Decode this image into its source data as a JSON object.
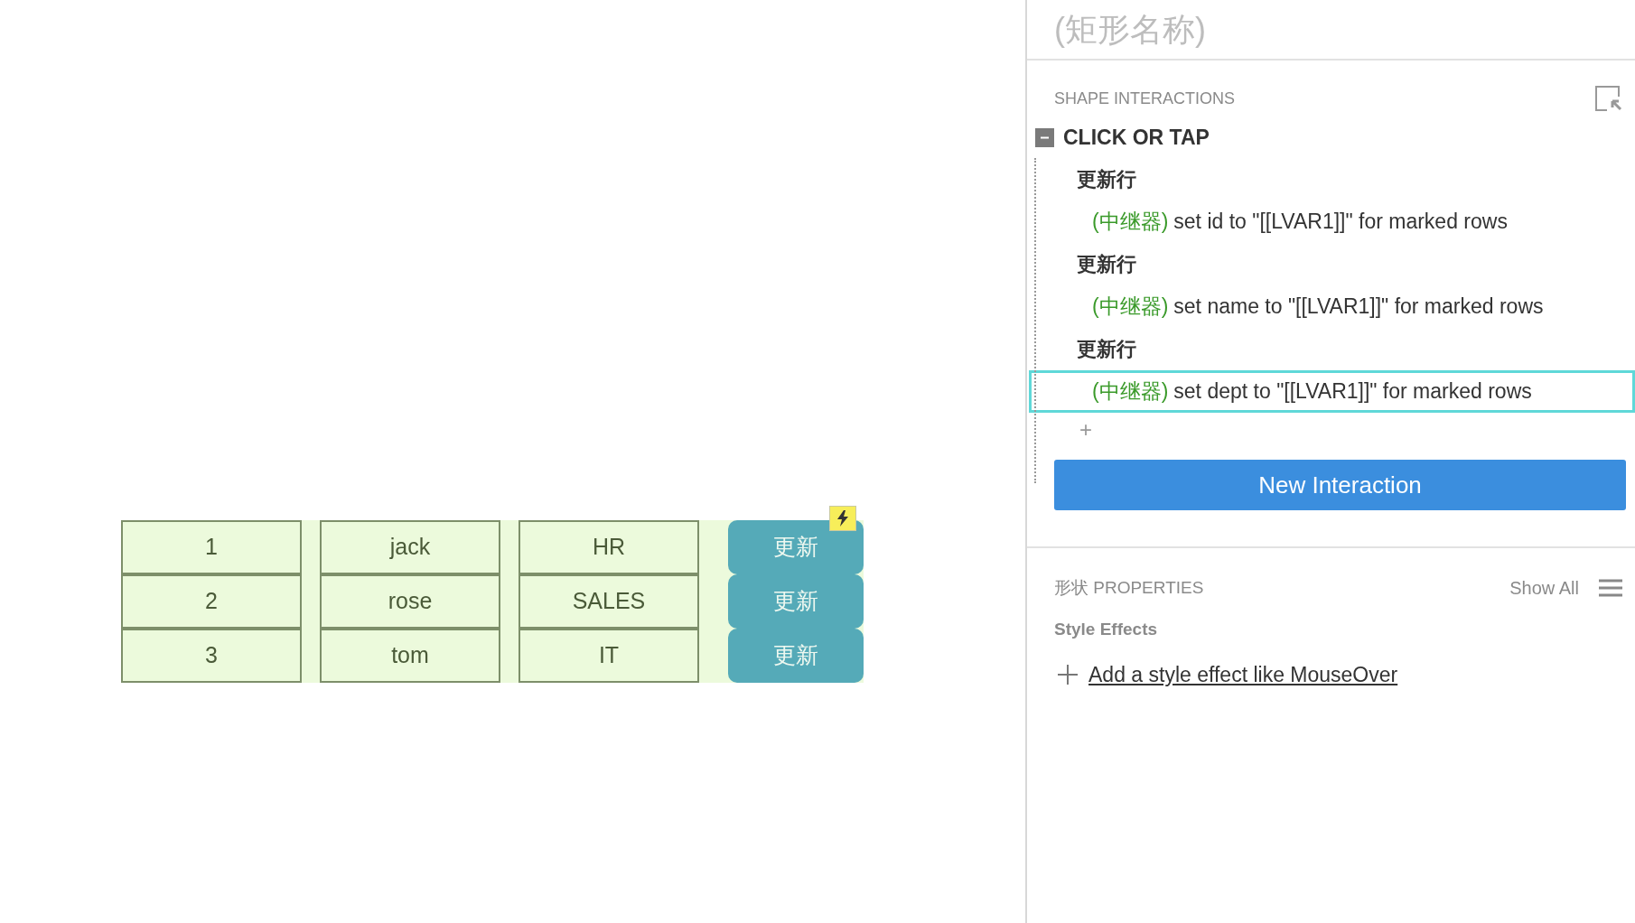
{
  "canvas": {
    "rows": [
      {
        "cells": [
          "1",
          "jack",
          "HR"
        ],
        "button": "更新"
      },
      {
        "cells": [
          "2",
          "rose",
          "SALES"
        ],
        "button": "更新"
      },
      {
        "cells": [
          "3",
          "tom",
          "IT"
        ],
        "button": "更新"
      }
    ]
  },
  "panel": {
    "title": "(矩形名称)",
    "interactions": {
      "heading": "SHAPE INTERACTIONS",
      "event": {
        "label": "CLICK OR TAP",
        "expanded": true,
        "cases": [
          {
            "name": "更新行",
            "action": {
              "target": "(中继器)",
              "text": "set id to \"[[LVAR1]]\" for marked rows",
              "selected": false
            }
          },
          {
            "name": "更新行",
            "action": {
              "target": "(中继器)",
              "text": "set name to \"[[LVAR1]]\" for marked rows",
              "selected": false
            }
          },
          {
            "name": "更新行",
            "action": {
              "target": "(中继器)",
              "text": "set dept to \"[[LVAR1]]\" for marked rows",
              "selected": true
            }
          }
        ]
      },
      "add_button": "+",
      "new_button": "New Interaction"
    },
    "properties": {
      "heading": "形状 PROPERTIES",
      "show_all": "Show All",
      "section": "Style Effects",
      "add_link": "Add a style effect like MouseOver"
    }
  }
}
